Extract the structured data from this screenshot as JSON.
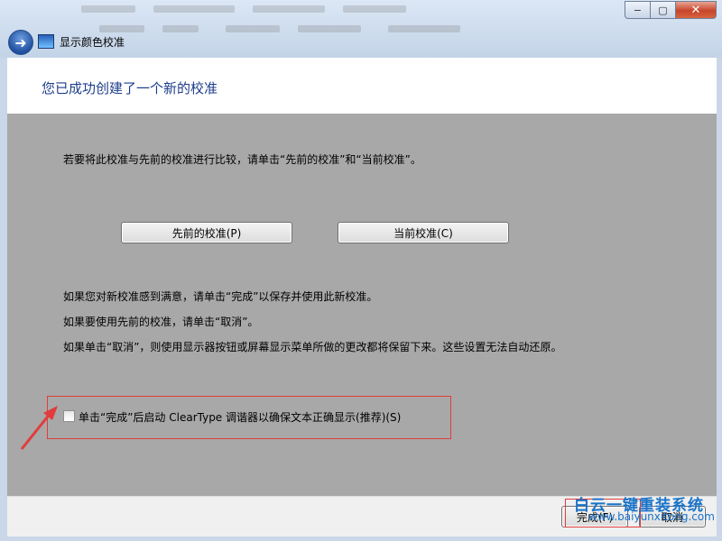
{
  "window": {
    "title": "显示颜色校准",
    "controls": {
      "minimize": "−",
      "maximize": "▢",
      "close": "✕"
    }
  },
  "header": {
    "heading": "您已成功创建了一个新的校准"
  },
  "content": {
    "compare_instruction": "若要将此校准与先前的校准进行比较，请单击“先前的校准”和“当前校准”。",
    "previous_button": "先前的校准(P)",
    "current_button": "当前校准(C)",
    "info_lines": [
      "如果您对新校准感到满意，请单击“完成”以保存并使用此新校准。",
      "如果要使用先前的校准，请单击“取消”。",
      "如果单击“取消”，则使用显示器按钮或屏幕显示菜单所做的更改都将保留下来。这些设置无法自动还原。"
    ],
    "cleartype_checkbox": {
      "label": "单击“完成”后启动 ClearType 调谐器以确保文本正确显示(推荐)(S)",
      "checked": false
    }
  },
  "footer": {
    "finish_button": "完成(F)",
    "cancel_button": "取消"
  },
  "watermark": {
    "text": "白云一键重装系统",
    "url": "www.baiyunxitong.com"
  },
  "colors": {
    "heading": "#1e3d8b",
    "content_bg": "#a8a8a8",
    "highlight": "#e23b3b",
    "watermark": "#1a73c8"
  }
}
